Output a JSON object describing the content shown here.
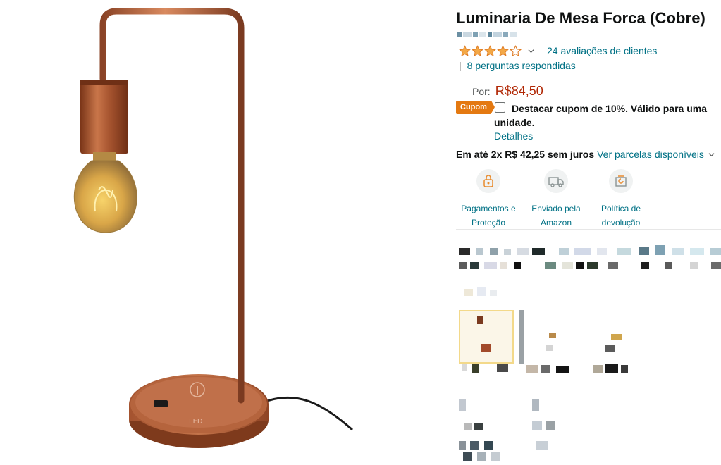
{
  "product": {
    "title": "Luminaria De Mesa Forca (Cobre)",
    "image_alt": "Luminária de mesa cobre com lâmpada filamento",
    "base_logo_text": "LED"
  },
  "rating": {
    "stars": 4.5,
    "reviews_link": "24 avaliações de clientes",
    "separator": "|",
    "questions_link": "8 perguntas respondidas"
  },
  "price": {
    "label": "Por:",
    "value": "R$84,50",
    "color": "#b12704"
  },
  "coupon": {
    "badge": "Cupom",
    "text": "Destacar cupom de 10%. Válido para uma unidade.",
    "details": "Detalhes",
    "badge_color": "#e47911"
  },
  "installments": {
    "text": "Em até 2x R$ 42,25 sem juros",
    "link": "Ver parcelas disponíveis"
  },
  "features": [
    {
      "icon": "lock-payment-icon",
      "label": "Pagamentos e Proteção"
    },
    {
      "icon": "truck-icon",
      "label": "Enviado pela Amazon"
    },
    {
      "icon": "return-icon",
      "label": "Política de devolução"
    }
  ],
  "colors": {
    "link": "#007185",
    "text": "#0f1111",
    "muted": "#565959"
  }
}
